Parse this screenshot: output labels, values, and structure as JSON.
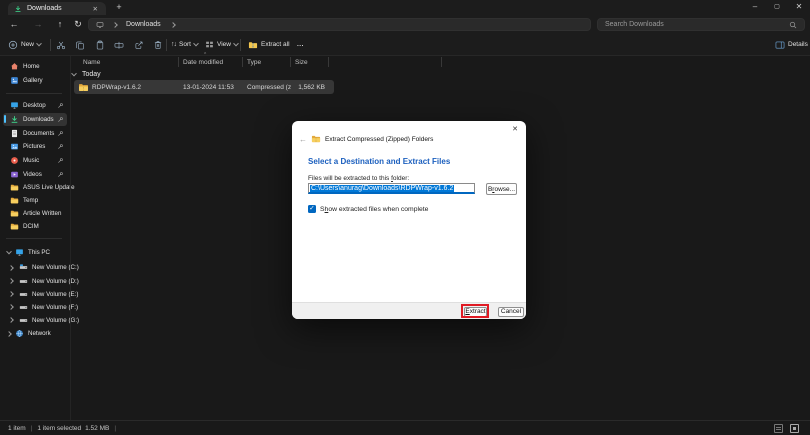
{
  "tab": {
    "title": "Downloads"
  },
  "nav": {
    "breadcrumb": "Downloads",
    "search_placeholder": "Search Downloads"
  },
  "commandbar": {
    "new_label": "New",
    "sort_label": "Sort",
    "view_label": "View",
    "extract_all_label": "Extract all",
    "more_label": "...",
    "details_label": "Details"
  },
  "list": {
    "columns": [
      "Name",
      "Date modified",
      "Type",
      "Size"
    ],
    "group_label": "Today",
    "rows": [
      {
        "name": "RDPWrap-v1.6.2",
        "date_modified": "13-01-2024 11:53",
        "type": "Compressed (zipp...",
        "size": "1,562 KB"
      }
    ]
  },
  "sidebar": {
    "items": [
      {
        "label": "Home"
      },
      {
        "label": "Gallery"
      },
      {
        "label": "Desktop"
      },
      {
        "label": "Downloads"
      },
      {
        "label": "Documents"
      },
      {
        "label": "Pictures"
      },
      {
        "label": "Music"
      },
      {
        "label": "Videos"
      },
      {
        "label": "ASUS Live Update"
      },
      {
        "label": "Temp"
      },
      {
        "label": "Article Written"
      },
      {
        "label": "DCIM"
      }
    ],
    "tree": [
      {
        "label": "This PC"
      },
      {
        "label": "New Volume (C:)"
      },
      {
        "label": "New Volume (D:)"
      },
      {
        "label": "New Volume (E:)"
      },
      {
        "label": "New Volume (F:)"
      },
      {
        "label": "New Volume (G:)"
      },
      {
        "label": "Network"
      }
    ]
  },
  "status": {
    "count": "1 item",
    "selected": "1 item selected",
    "size": "1.52 MB"
  },
  "dialog": {
    "title": "Extract Compressed (Zipped) Folders",
    "heading": "Select a Destination and Extract Files",
    "files_label": {
      "pre": "Files will be extracted to this ",
      "u": "f",
      "post": "older:"
    },
    "path": "C:\\Users\\anurag\\Downloads\\RDPWrap-v1.6.2",
    "browse": {
      "pre": "B",
      "u": "r",
      "post": "owse..."
    },
    "checkbox": {
      "pre": "S",
      "u": "h",
      "post": "ow extracted files when complete"
    },
    "extract": {
      "pre": "",
      "u": "E",
      "post": "xtract"
    },
    "cancel": "Cancel"
  }
}
